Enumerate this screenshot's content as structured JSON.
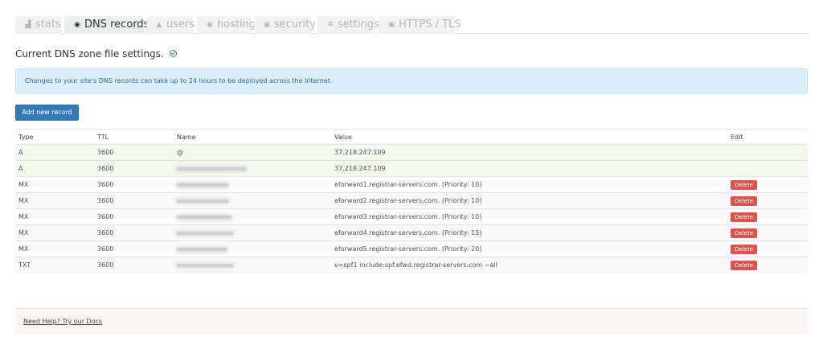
{
  "tabs": [
    {
      "label": "stats",
      "icon": "bar-chart-icon",
      "glyph": "▟"
    },
    {
      "label": "DNS records",
      "icon": "globe-icon",
      "glyph": "◉"
    },
    {
      "label": "users",
      "icon": "user-icon",
      "glyph": "▲"
    },
    {
      "label": "hosting",
      "icon": "globe-icon",
      "glyph": "◉"
    },
    {
      "label": "security",
      "icon": "lock-icon",
      "glyph": "▣"
    },
    {
      "label": "settings",
      "icon": "gear-icon",
      "glyph": "✲"
    },
    {
      "label": "HTTPS / TLS",
      "icon": "lock-icon",
      "glyph": "▣"
    }
  ],
  "active_tab": "DNS records",
  "heading": "Current DNS zone file settings.",
  "alert_text": "Changes to your site's DNS records can take up to 24 hours to be deployed across the Internet.",
  "add_button_label": "Add new record",
  "table": {
    "headers": [
      "Type",
      "TTL",
      "Name",
      "Value",
      "Edit"
    ],
    "rows": [
      {
        "type": "A",
        "ttl": "3600",
        "name": "@",
        "value": "37.218.247.109",
        "edit": ""
      },
      {
        "type": "A",
        "ttl": "3600",
        "name": "",
        "value": "37.218.247.109",
        "edit": ""
      },
      {
        "type": "MX",
        "ttl": "3600",
        "name": "",
        "value": "eforward1.registrar-servers.com. (Priority: 10)",
        "edit": "Delete"
      },
      {
        "type": "MX",
        "ttl": "3600",
        "name": "",
        "value": "eforward2.registrar-servers.com. (Priority: 10)",
        "edit": "Delete"
      },
      {
        "type": "MX",
        "ttl": "3600",
        "name": "",
        "value": "eforward3.registrar-servers.com. (Priority: 10)",
        "edit": "Delete"
      },
      {
        "type": "MX",
        "ttl": "3600",
        "name": "",
        "value": "eforward4.registrar-servers.com. (Priority: 15)",
        "edit": "Delete"
      },
      {
        "type": "MX",
        "ttl": "3600",
        "name": "",
        "value": "eforward5.registrar-servers.com. (Priority: 20)",
        "edit": "Delete"
      },
      {
        "type": "TXT",
        "ttl": "3600",
        "name": "",
        "value": "v=spf1 include:spf.efwd.registrar-servers.com ~all",
        "edit": "Delete"
      }
    ]
  },
  "footer_link": "Need Help? Try our Docs",
  "colors": {
    "delete": "#d9534f",
    "primary": "#337ab7",
    "alert_bg": "#d9edf7",
    "success": "#3f8f3f"
  }
}
